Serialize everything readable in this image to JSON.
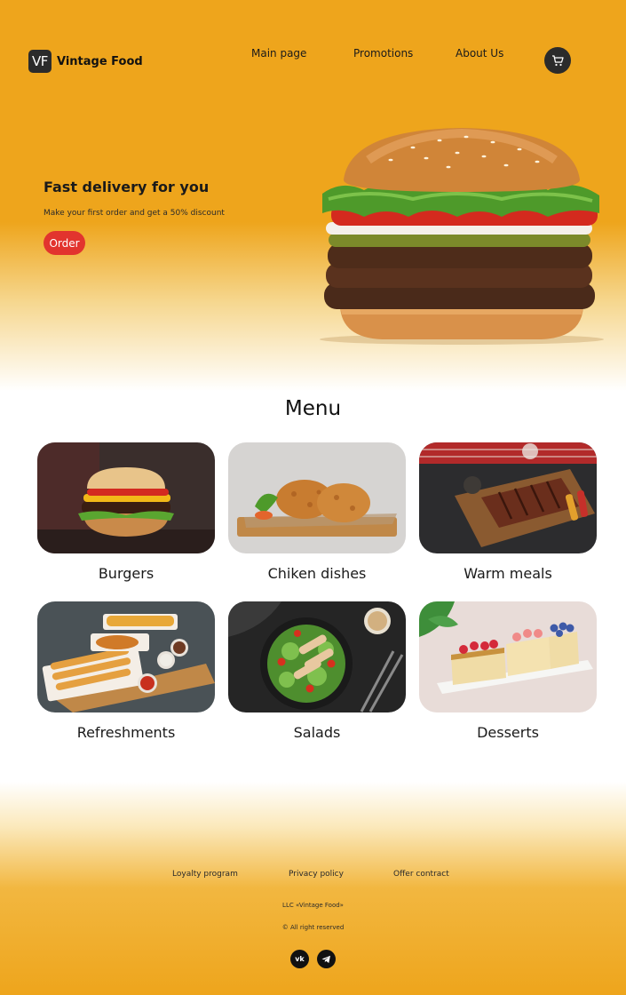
{
  "header": {
    "logo_badge": "VF",
    "brand": "Vintage Food",
    "nav": [
      "Main page",
      "Promotions",
      "About Us"
    ],
    "cart_icon": "cart-icon"
  },
  "hero": {
    "title": "Fast delivery for you",
    "subtitle": "Make your first order and get a 50% discount",
    "order_label": "Order"
  },
  "menu": {
    "title": "Menu",
    "items": [
      {
        "label": "Burgers"
      },
      {
        "label": "Chiken dishes"
      },
      {
        "label": "Warm meals"
      },
      {
        "label": "Refreshments"
      },
      {
        "label": "Salads"
      },
      {
        "label": "Desserts"
      }
    ]
  },
  "footer": {
    "links": [
      "Loyalty program",
      "Privacy policy",
      "Offer contract"
    ],
    "company": "LLC «Vintage Food»",
    "rights": "© All right reserved",
    "social": [
      "vk-icon",
      "telegram-icon"
    ]
  },
  "colors": {
    "primary": "#EEA51C",
    "accent": "#E2342E",
    "dark": "#2B2B2B"
  }
}
